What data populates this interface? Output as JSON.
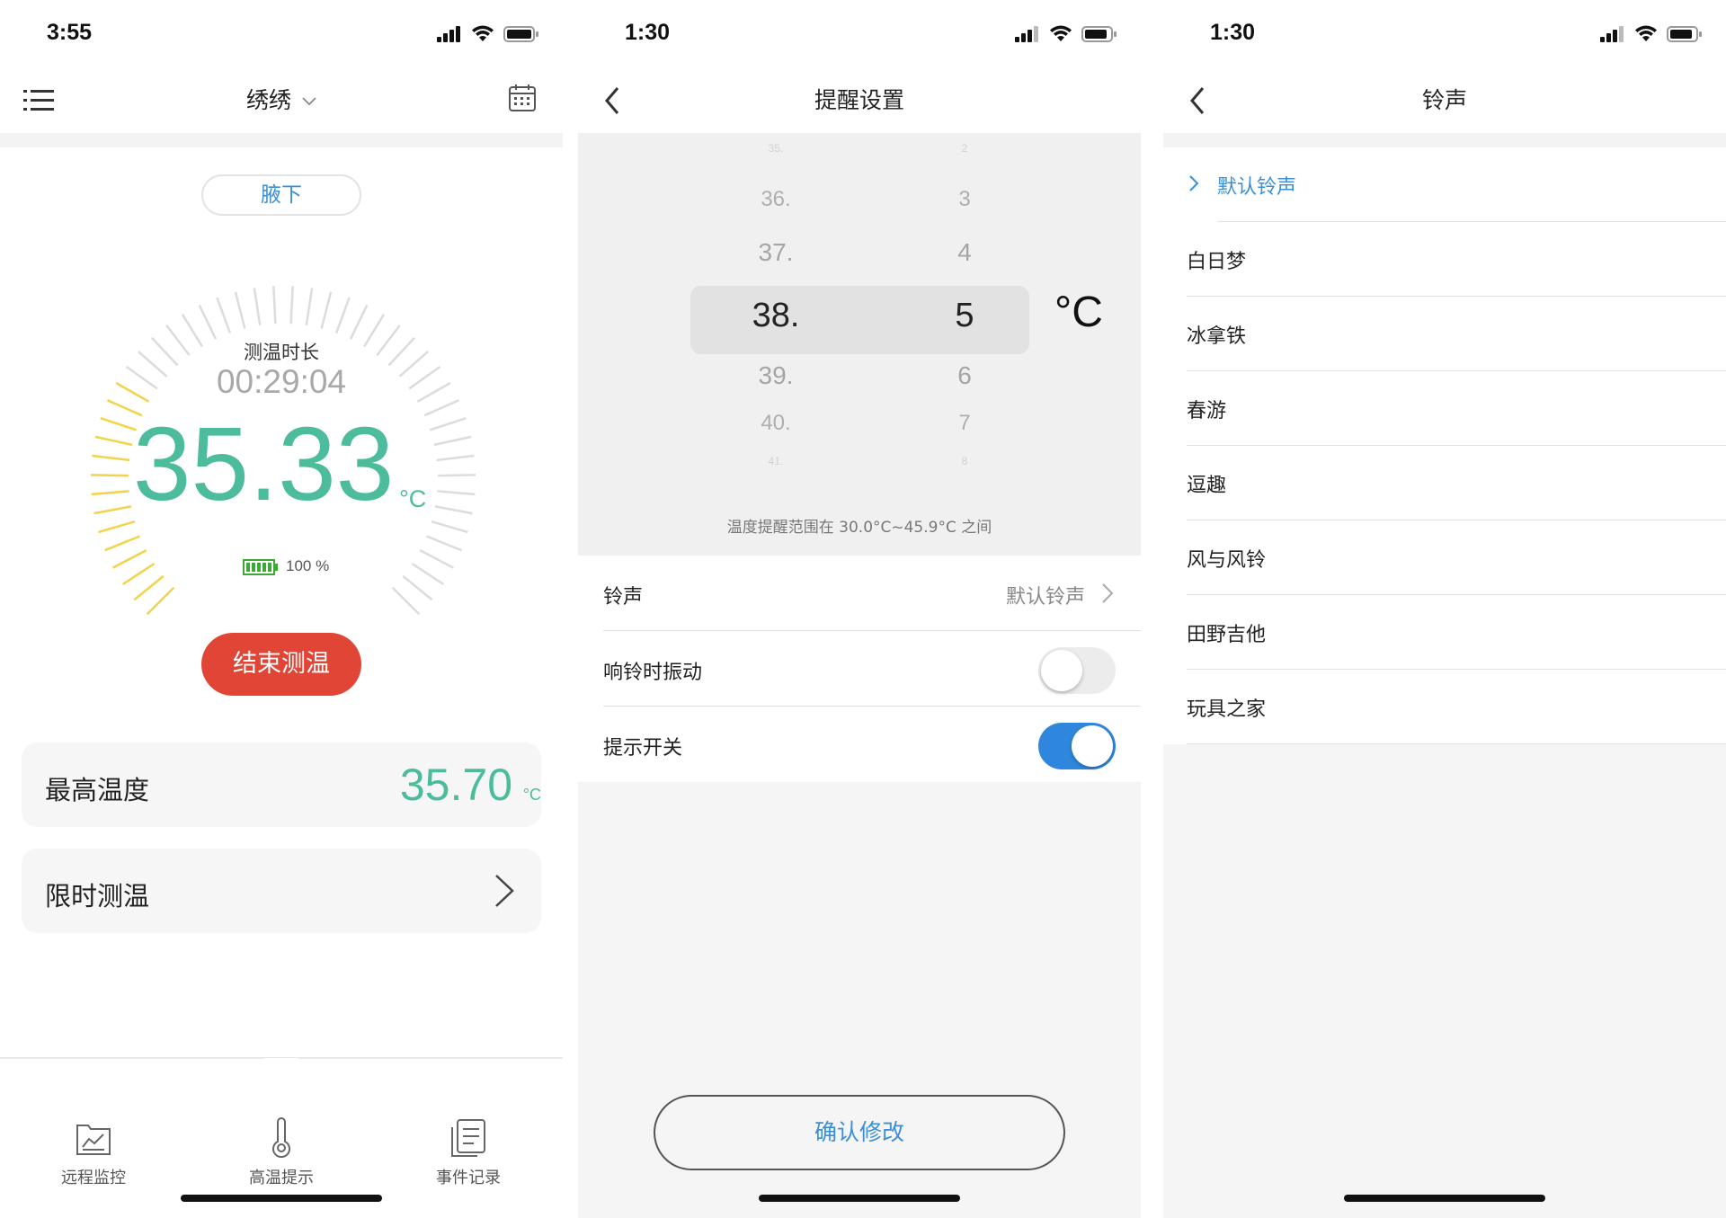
{
  "screen1": {
    "status": {
      "time": "3:55"
    },
    "nav": {
      "title": "绣绣"
    },
    "position": "腋下",
    "duration_label": "测温时长",
    "duration_value": "00:29:04",
    "temperature": "35.33",
    "temp_unit": "°C",
    "battery_percent": "100 %",
    "battery_level": 1.0,
    "end_button": "结束测温",
    "max_card": {
      "label": "最高温度",
      "value": "35.70",
      "unit": "°C"
    },
    "limit_card": {
      "label": "限时测温"
    },
    "tabs": [
      {
        "label": "远程监控",
        "icon": "chart-monitor-icon"
      },
      {
        "label": "高温提示",
        "icon": "thermometer-icon"
      },
      {
        "label": "事件记录",
        "icon": "document-list-icon"
      }
    ],
    "colors": {
      "accent": "#4cbc9c",
      "gauge_active": "#f2d34a",
      "end_button": "#e04535"
    }
  },
  "screen2": {
    "status": {
      "time": "1:30"
    },
    "nav": {
      "title": "提醒设置"
    },
    "picker": {
      "integer_items": [
        "35.",
        "36.",
        "37.",
        "38.",
        "39.",
        "40.",
        "41."
      ],
      "decimal_items": [
        "2",
        "3",
        "4",
        "5",
        "6",
        "7",
        "8"
      ],
      "selected_integer": "38.",
      "selected_decimal": "5",
      "unit": "°C"
    },
    "range_note": "温度提醒范围在 30.0°C~45.9°C 之间",
    "rows": {
      "ringtone_label": "铃声",
      "ringtone_value": "默认铃声",
      "vibrate_label": "响铃时振动",
      "vibrate_on": false,
      "reminder_label": "提示开关",
      "reminder_on": true
    },
    "confirm_button": "确认修改",
    "colors": {
      "toggle_on": "#2f87dd",
      "link": "#3b8fd6"
    }
  },
  "screen3": {
    "status": {
      "time": "1:30"
    },
    "nav": {
      "title": "铃声"
    },
    "ringtones": [
      {
        "name": "默认铃声",
        "selected": true
      },
      {
        "name": "白日梦",
        "selected": false
      },
      {
        "name": "冰拿铁",
        "selected": false
      },
      {
        "name": "春游",
        "selected": false
      },
      {
        "name": "逗趣",
        "selected": false
      },
      {
        "name": "风与风铃",
        "selected": false
      },
      {
        "name": "田野吉他",
        "selected": false
      },
      {
        "name": "玩具之家",
        "selected": false
      }
    ]
  }
}
